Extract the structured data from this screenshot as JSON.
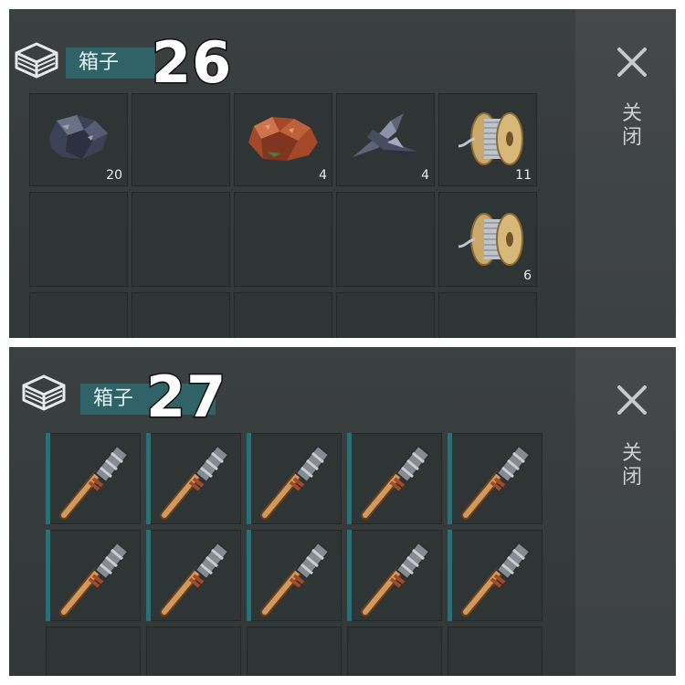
{
  "panels": [
    {
      "container_label": "箱子",
      "number": "26",
      "close_label": "关闭",
      "rows": [
        [
          {
            "item": "metal-ore-icon",
            "count": "20"
          },
          {
            "item": "",
            "count": ""
          },
          {
            "item": "copper-ore-icon",
            "count": "4"
          },
          {
            "item": "metal-shards-icon",
            "count": "4"
          },
          {
            "item": "wire-spool-icon",
            "count": "11"
          }
        ],
        [
          {
            "item": "",
            "count": ""
          },
          {
            "item": "",
            "count": ""
          },
          {
            "item": "",
            "count": ""
          },
          {
            "item": "",
            "count": ""
          },
          {
            "item": "wire-spool-icon",
            "count": "6"
          }
        ],
        [
          {
            "item": "",
            "count": ""
          },
          {
            "item": "",
            "count": ""
          },
          {
            "item": "",
            "count": ""
          },
          {
            "item": "",
            "count": ""
          },
          {
            "item": "",
            "count": ""
          }
        ]
      ]
    },
    {
      "container_label": "箱子",
      "number": "27",
      "close_label": "关闭",
      "rows": [
        [
          {
            "item": "steel-club-icon",
            "count": ""
          },
          {
            "item": "steel-club-icon",
            "count": ""
          },
          {
            "item": "steel-club-icon",
            "count": ""
          },
          {
            "item": "steel-club-icon",
            "count": ""
          },
          {
            "item": "steel-club-icon",
            "count": ""
          }
        ],
        [
          {
            "item": "steel-club-icon",
            "count": ""
          },
          {
            "item": "steel-club-icon",
            "count": ""
          },
          {
            "item": "steel-club-icon",
            "count": ""
          },
          {
            "item": "steel-club-icon",
            "count": ""
          },
          {
            "item": "steel-club-icon",
            "count": ""
          }
        ],
        [
          {
            "item": "",
            "count": ""
          },
          {
            "item": "",
            "count": ""
          },
          {
            "item": "",
            "count": ""
          },
          {
            "item": "",
            "count": ""
          },
          {
            "item": "",
            "count": ""
          }
        ]
      ]
    }
  ],
  "colors": {
    "background": "#373c3c",
    "slot": "#2f3435",
    "label_bg": "#2f6367",
    "slot_accent": "#2d6e74"
  }
}
